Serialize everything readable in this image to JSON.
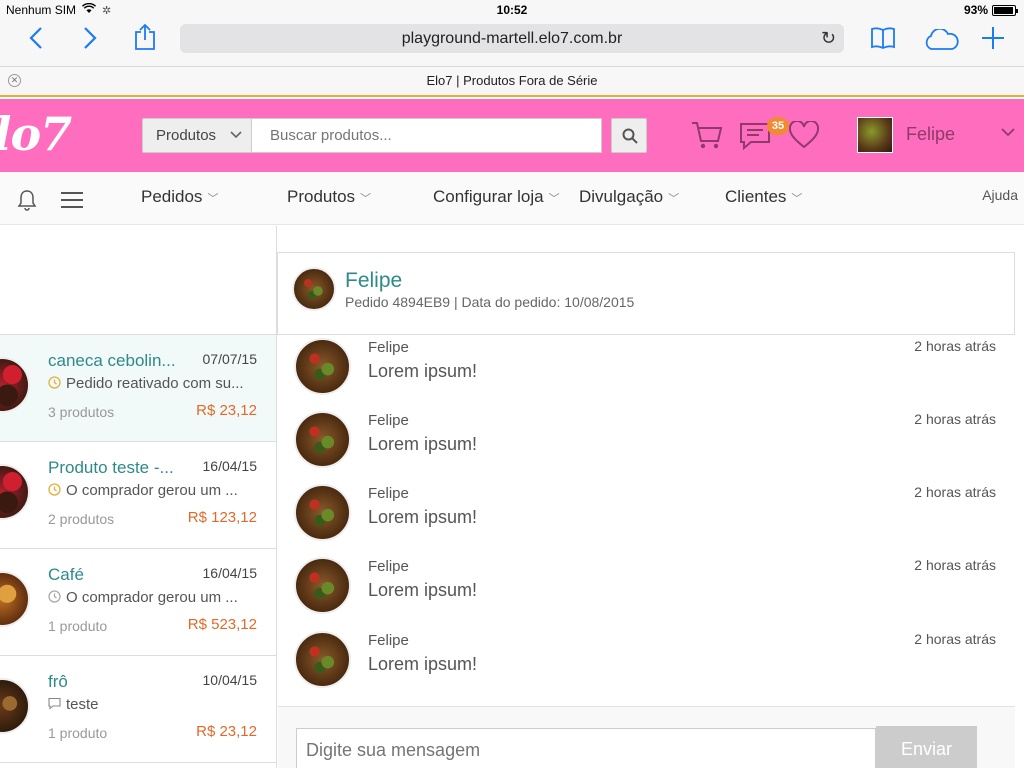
{
  "status_bar": {
    "carrier": "Nenhum SIM",
    "time": "10:52",
    "battery": "93%",
    "battery_level": 0.93
  },
  "browser": {
    "url": "playground-martell.elo7.com.br",
    "tab_title": "Elo7 | Produtos Fora de Série"
  },
  "header": {
    "logo": "lo7",
    "search_category": "Produtos",
    "search_placeholder": "Buscar produtos...",
    "messages_badge": "35",
    "user_name": "Felipe"
  },
  "nav": {
    "items": [
      {
        "label": "Pedidos"
      },
      {
        "label": "Produtos"
      },
      {
        "label": "Configurar loja"
      },
      {
        "label": "Divulgação"
      },
      {
        "label": "Clientes"
      }
    ],
    "help": "Ajuda"
  },
  "conversations": [
    {
      "title": "caneca cebolin...",
      "date": "07/07/15",
      "preview": "Pedido reativado com su...",
      "status_icon": "clock-icon",
      "quantity": "3 produtos",
      "price": "R$ 23,12",
      "thumb": "strawberry"
    },
    {
      "title": "Produto teste -...",
      "date": "16/04/15",
      "preview": "O comprador gerou um ...",
      "status_icon": "clock-icon",
      "quantity": "2 produtos",
      "price": "R$ 123,12",
      "thumb": "strawberry"
    },
    {
      "title": "Café",
      "date": "16/04/15",
      "preview": "O comprador gerou um ...",
      "status_icon": "clock-icon",
      "quantity": "1 produto",
      "price": "R$ 523,12",
      "thumb": "bread"
    },
    {
      "title": "frô",
      "date": "10/04/15",
      "preview": "teste",
      "status_icon": "speech-bubble-icon",
      "quantity": "1 produto",
      "price": "R$ 23,12",
      "thumb": "choc"
    }
  ],
  "chat": {
    "name": "Felipe",
    "meta": "Pedido 4894EB9 | Data do pedido: 10/08/2015",
    "messages": [
      {
        "author": "Felipe",
        "time": "2 horas atrás",
        "text": "Lorem ipsum!"
      },
      {
        "author": "Felipe",
        "time": "2 horas atrás",
        "text": "Lorem ipsum!"
      },
      {
        "author": "Felipe",
        "time": "2 horas atrás",
        "text": "Lorem ipsum!"
      },
      {
        "author": "Felipe",
        "time": "2 horas atrás",
        "text": "Lorem ipsum!"
      },
      {
        "author": "Felipe",
        "time": "2 horas atrás",
        "text": "Lorem ipsum!"
      }
    ],
    "input_placeholder": "Digite sua mensagem",
    "send_label": "Enviar"
  },
  "colors": {
    "brand_pink": "#ff6ebe",
    "accent_teal": "#2e8a8a",
    "price_orange": "#e06a2a",
    "ios_blue": "#1a7cf5"
  }
}
